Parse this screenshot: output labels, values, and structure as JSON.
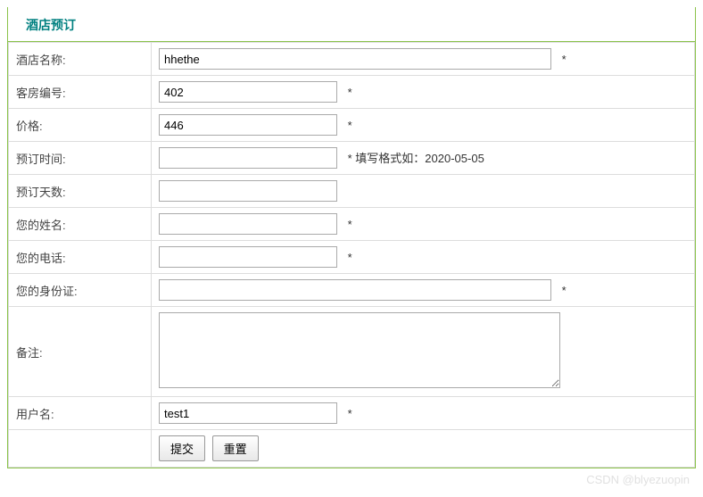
{
  "header": {
    "title": "酒店预订"
  },
  "form": {
    "hotel_name": {
      "label": "酒店名称:",
      "value": "hhethe",
      "hint": "*"
    },
    "room_no": {
      "label": "客房编号:",
      "value": "402",
      "hint": "*"
    },
    "price": {
      "label": "价格:",
      "value": "446",
      "hint": "*"
    },
    "reserve_time": {
      "label": "预订时间:",
      "value": "",
      "hint": "* 填写格式如：2020-05-05"
    },
    "reserve_days": {
      "label": "预订天数:",
      "value": "",
      "hint": ""
    },
    "your_name": {
      "label": "您的姓名:",
      "value": "",
      "hint": "*"
    },
    "your_phone": {
      "label": "您的电话:",
      "value": "",
      "hint": "*"
    },
    "your_id": {
      "label": "您的身份证:",
      "value": "",
      "hint": "*"
    },
    "remark": {
      "label": "备注:",
      "value": ""
    },
    "username": {
      "label": "用户名:",
      "value": "test1",
      "hint": "*"
    }
  },
  "buttons": {
    "submit": "提交",
    "reset": "重置"
  },
  "watermark": "CSDN @blyezuopin"
}
